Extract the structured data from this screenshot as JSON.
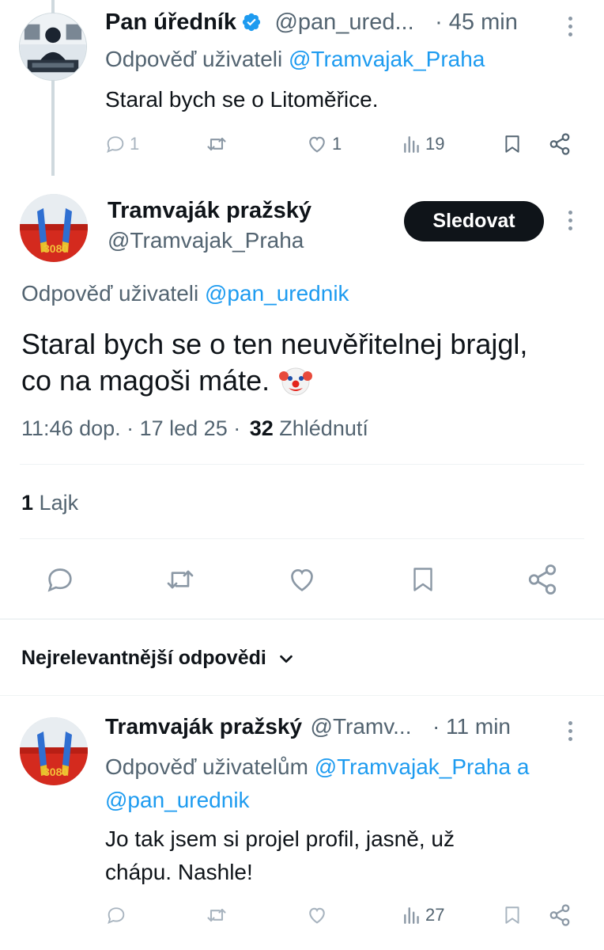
{
  "tweet1": {
    "name": "Pan úředník",
    "handle": "@pan_ured...",
    "time": "· 45 min",
    "reply_prefix": "Odpověď uživateli",
    "reply_to": "@Tramvajak_Praha",
    "text": "Staral bych se o Litoměřice.",
    "replies": "1",
    "likes": "1",
    "views": "19"
  },
  "main_tweet": {
    "name": "Tramvaják pražský",
    "handle": "@Tramvajak_Praha",
    "follow_label": "Sledovat",
    "reply_prefix": "Odpověď uživateli",
    "reply_to": "@pan_urednik",
    "text_line1": "Staral bych se o ten neuvěřitelnej brajgl,",
    "text_line2": "co na magoši máte.",
    "emoji": "🤡",
    "timestamp": "11:46 dop. · 17 led 25 ·",
    "views_count": "32",
    "views_label": "Zhlédnutí",
    "likes_count": "1",
    "likes_label": "Lajk"
  },
  "sort": {
    "label": "Nejrelevantnější odpovědi"
  },
  "reply": {
    "name": "Tramvaják pražský",
    "handle": "@Tramv...",
    "time": "· 11 min",
    "reply_prefix": "Odpověď uživatelům",
    "reply_to1": "@Tramvajak_Praha",
    "conj": "a",
    "reply_to2": "@pan_urednik",
    "text_line1": "Jo tak jsem si projel profil, jasně, už",
    "text_line2": "chápu. Nashle!",
    "views": "27"
  },
  "colors": {
    "accent": "#1d9bf0",
    "text": "#0f1419",
    "muted": "#536471",
    "icon": "#8b98a5",
    "follow_bg": "#0f1419"
  },
  "icons": [
    "reply-icon",
    "retweet-icon",
    "like-icon",
    "views-icon",
    "bookmark-icon",
    "share-icon",
    "more-icon",
    "verified-icon",
    "chevron-down-icon"
  ]
}
